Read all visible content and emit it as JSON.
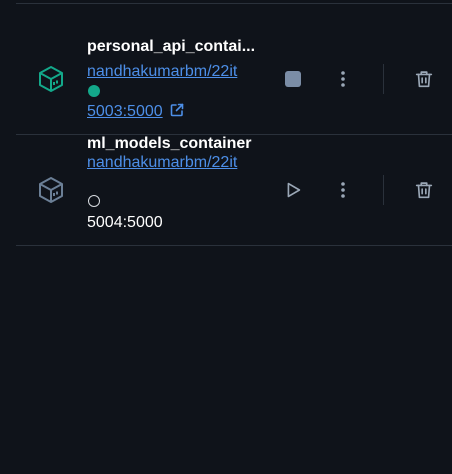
{
  "containers": [
    {
      "name": "personal_api_contai...",
      "image": "nandhakumarbm/22it",
      "status": "running",
      "ports": "5003:5000",
      "port_is_link": true,
      "cube_color": "#13a88a"
    },
    {
      "name": "ml_models_container",
      "image": "nandhakumarbm/22it",
      "status": "stopped",
      "ports": "5004:5000",
      "port_is_link": false,
      "cube_color": "#6b7f96"
    }
  ],
  "icons": {
    "container": "cube-icon",
    "running_status": "running-dot-icon",
    "stopped_status": "stopped-circle-icon",
    "external_link": "external-link-icon",
    "stop": "stop-icon",
    "start": "play-icon",
    "more": "more-vertical-icon",
    "delete": "trash-icon"
  },
  "colors": {
    "background": "#0f131a",
    "divider": "#2a313b",
    "link": "#4d8fe8",
    "running": "#13a88a",
    "stop_button": "#7b8da6",
    "icon_gray": "#9aa7b6"
  }
}
